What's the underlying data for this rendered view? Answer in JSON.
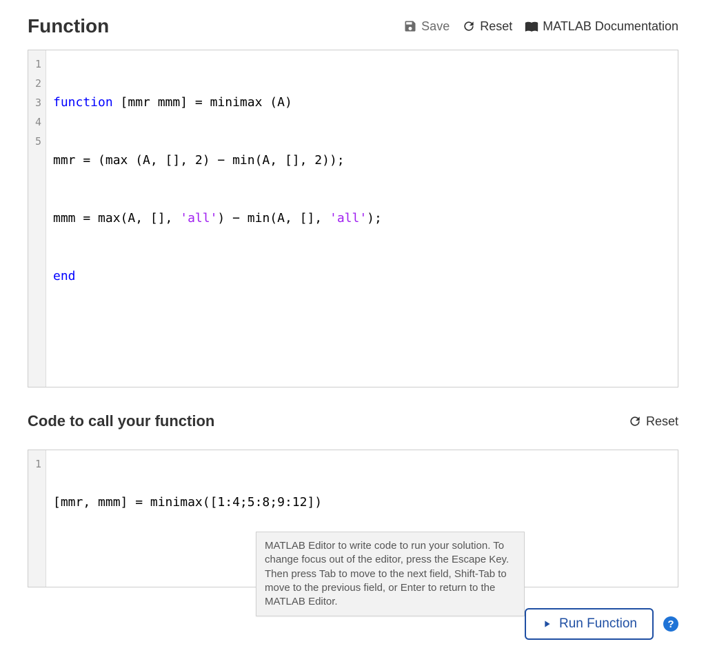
{
  "function_section": {
    "title": "Function",
    "toolbar": {
      "save": "Save",
      "reset": "Reset",
      "docs": "MATLAB Documentation"
    },
    "code": {
      "line1_kw": "function",
      "line1_rest": " [mmr mmm] = minimax (A)",
      "line2": "mmr = (max (A, [], 2) − min(A, [], 2));",
      "line3_a": "mmm = max(A, [], ",
      "line3_s1": "'all'",
      "line3_b": ") − min(A, [], ",
      "line3_s2": "'all'",
      "line3_c": ");",
      "line4_kw": "end"
    },
    "line_numbers": [
      "1",
      "2",
      "3",
      "4",
      "5"
    ]
  },
  "caller_section": {
    "title": "Code to call your function",
    "toolbar": {
      "reset": "Reset"
    },
    "code": {
      "line1": "[mmr, mmm] = minimax([1:4;5:8;9:12])"
    },
    "line_numbers": [
      "1"
    ]
  },
  "tooltip_text": "MATLAB Editor to write code to run your solution. To change focus out of the editor, press the Escape Key. Then press Tab to move to the next field, Shift-Tab to move to the previous field, or Enter to return to the MATLAB Editor.",
  "run_button": "Run Function"
}
